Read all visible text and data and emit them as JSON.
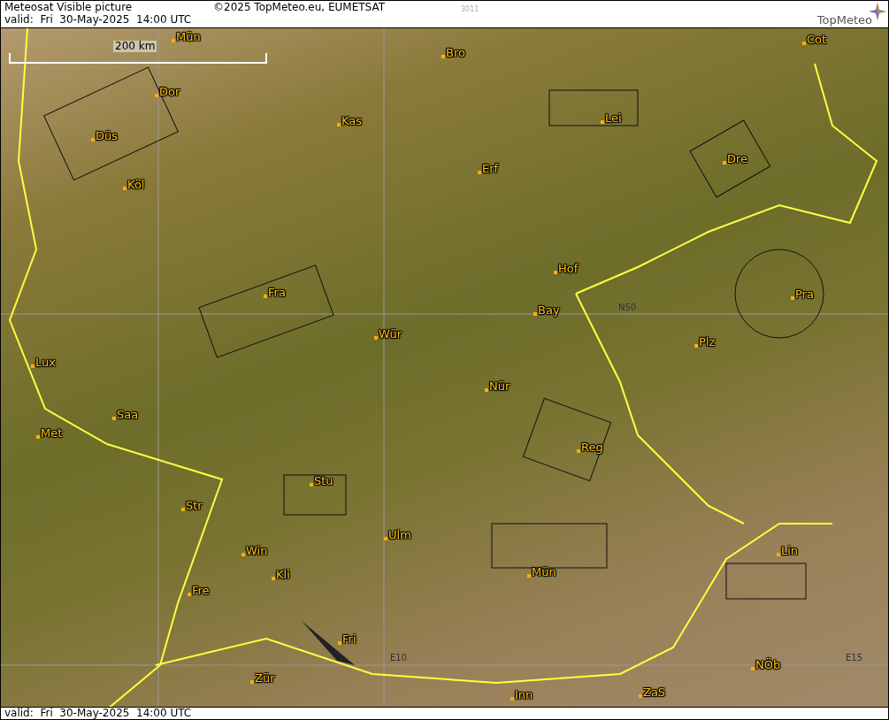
{
  "header": {
    "title": "Meteosat Visible picture",
    "valid": "valid:  Fri  30-May-2025  14:00 UTC",
    "copyright": "©2025 TopMeteo.eu, EUMETSAT",
    "code": "3011",
    "logo": "TopMeteo"
  },
  "map": {
    "scale": "200 km",
    "places": [
      {
        "label": "Mün"
      },
      {
        "label": "Bro"
      },
      {
        "label": "Cot"
      },
      {
        "label": "Dor"
      },
      {
        "label": "Kas"
      },
      {
        "label": "Lei"
      },
      {
        "label": "Düs"
      },
      {
        "label": "Erf"
      },
      {
        "label": "Dre"
      },
      {
        "label": "Köl"
      },
      {
        "label": "Hof"
      },
      {
        "label": "Fra"
      },
      {
        "label": "Pra"
      },
      {
        "label": "Bay"
      },
      {
        "label": "Wür"
      },
      {
        "label": "Plz"
      },
      {
        "label": "Lux"
      },
      {
        "label": "Nür"
      },
      {
        "label": "Saa"
      },
      {
        "label": "Met"
      },
      {
        "label": "Reg"
      },
      {
        "label": "Stu"
      },
      {
        "label": "Str"
      },
      {
        "label": "Ulm"
      },
      {
        "label": "Lin"
      },
      {
        "label": "Win"
      },
      {
        "label": "Kli"
      },
      {
        "label": "Mün"
      },
      {
        "label": "Fre"
      },
      {
        "label": "Fri"
      },
      {
        "label": "NÖb"
      },
      {
        "label": "Zür"
      },
      {
        "label": "Inn"
      },
      {
        "label": "ZaS"
      }
    ],
    "grid_labels": [
      {
        "label": "N50"
      },
      {
        "label": "E10"
      },
      {
        "label": "E15"
      }
    ]
  },
  "footer": {
    "valid": "valid:  Fri  30-May-2025  14:00 UTC"
  }
}
